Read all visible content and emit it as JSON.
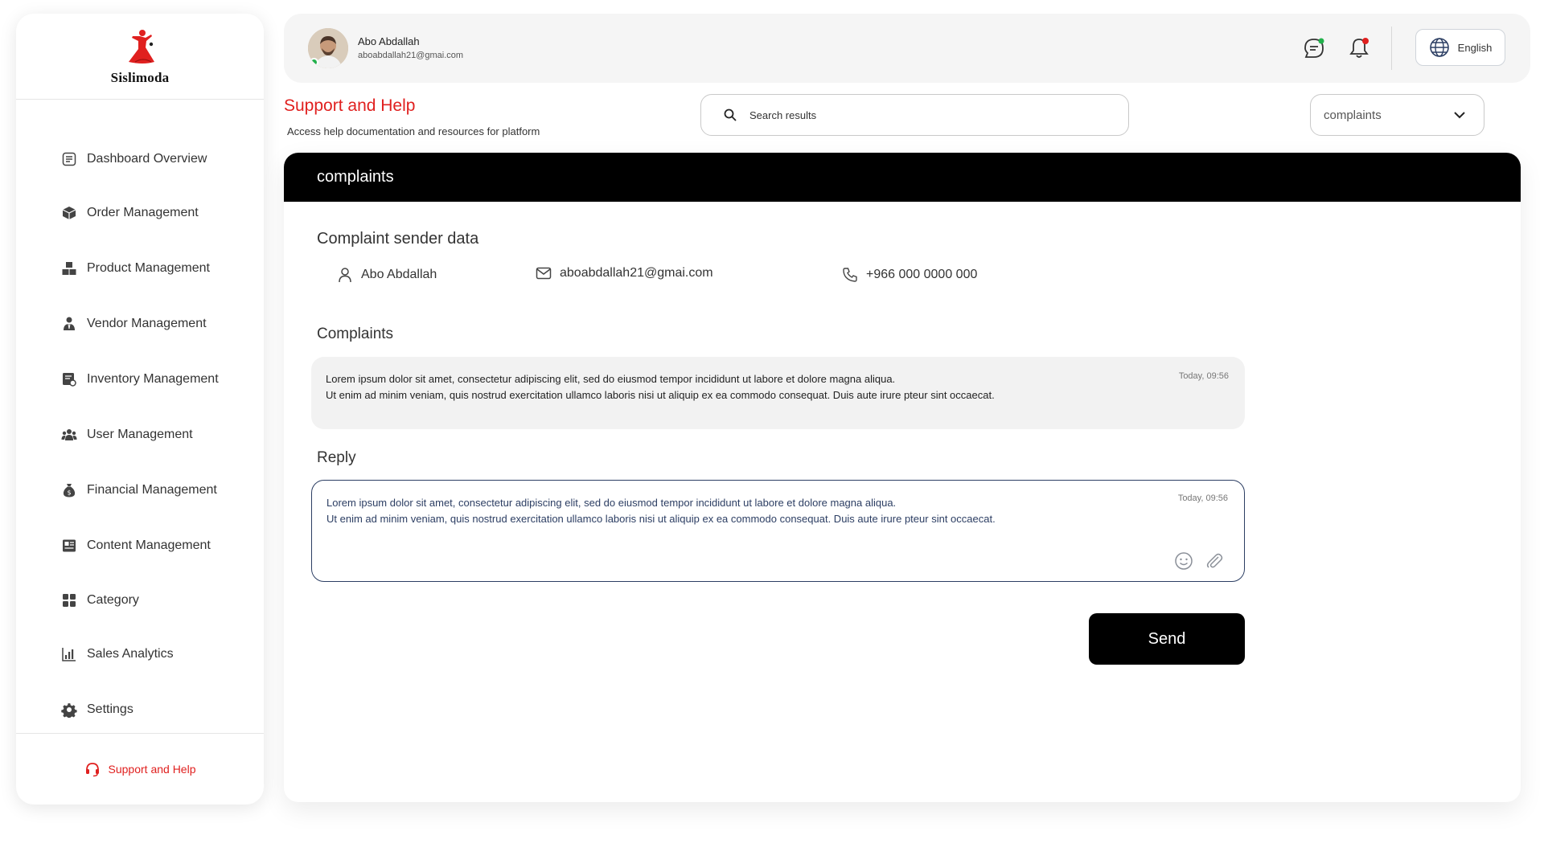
{
  "brand": {
    "name": "Sislimoda",
    "accent": "#e0201f"
  },
  "sidebar": {
    "items": [
      {
        "label": "Dashboard Overview",
        "icon": "dashboard-icon"
      },
      {
        "label": "Order Management",
        "icon": "box-icon"
      },
      {
        "label": "Product Management",
        "icon": "boxes-icon"
      },
      {
        "label": "Vendor Management",
        "icon": "vendor-icon"
      },
      {
        "label": "Inventory Management",
        "icon": "inventory-icon"
      },
      {
        "label": "User Management",
        "icon": "users-icon"
      },
      {
        "label": "Financial Management",
        "icon": "money-bag-icon"
      },
      {
        "label": "Content Management",
        "icon": "content-icon"
      },
      {
        "label": "Category",
        "icon": "grid-icon"
      },
      {
        "label": "Sales Analytics",
        "icon": "chart-icon"
      },
      {
        "label": "Settings",
        "icon": "gear-icon"
      }
    ],
    "footer": {
      "label": "Support and Help",
      "icon": "headset-icon"
    }
  },
  "topbar": {
    "user": {
      "name": "Abo Abdallah",
      "email": "aboabdallah21@gmai.com",
      "status_color": "#22b14c"
    },
    "language": "English"
  },
  "page": {
    "title": "Support and Help",
    "subtitle": "Access help documentation and resources for platform"
  },
  "search": {
    "placeholder": "Search results"
  },
  "filter": {
    "selected": "complaints"
  },
  "card": {
    "header": "complaints",
    "sender_title": "Complaint sender data",
    "sender": {
      "name": "Abo Abdallah",
      "email": "aboabdallah21@gmai.com",
      "phone": "+966 000 0000 000"
    },
    "complaints_title": "Complaints",
    "complaint": {
      "line1": "Lorem ipsum dolor sit amet, consectetur adipiscing elit, sed do eiusmod tempor incididunt ut labore et dolore magna aliqua.",
      "line2": "Ut enim ad minim veniam, quis nostrud exercitation ullamco laboris nisi ut aliquip ex ea commodo consequat. Duis aute irure pteur sint occaecat.",
      "time": "Today, 09:56"
    },
    "reply_title": "Reply",
    "reply": {
      "line1": "Lorem ipsum dolor sit amet, consectetur adipiscing elit, sed do eiusmod tempor incididunt ut labore et dolore magna aliqua.",
      "line2": "Ut enim ad minim veniam, quis nostrud exercitation ullamco laboris nisi ut aliquip ex ea commodo consequat. Duis aute irure pteur sint occaecat.",
      "time": "Today, 09:56"
    },
    "send_label": "Send"
  }
}
